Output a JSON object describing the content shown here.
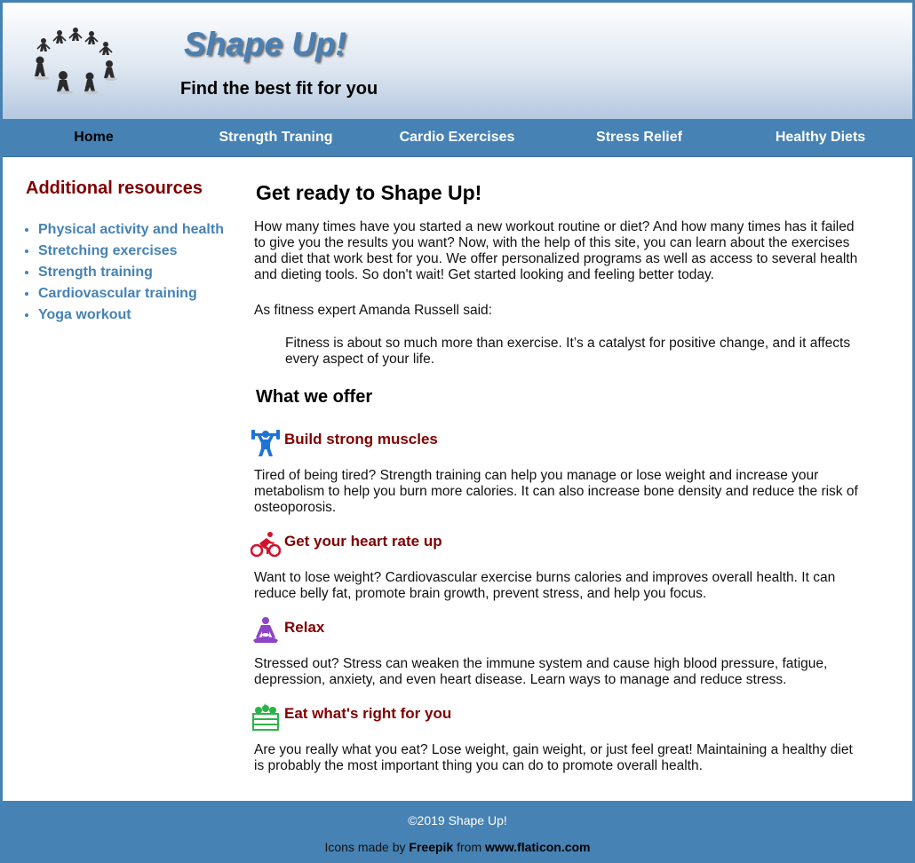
{
  "header": {
    "title": "Shape Up!",
    "tagline": "Find the best fit for you"
  },
  "nav": {
    "items": [
      {
        "label": "Home",
        "active": true
      },
      {
        "label": "Strength Traning",
        "active": false
      },
      {
        "label": "Cardio Exercises",
        "active": false
      },
      {
        "label": "Stress Relief",
        "active": false
      },
      {
        "label": "Healthy Diets",
        "active": false
      }
    ]
  },
  "sidebar": {
    "title": "Additional resources",
    "links": [
      "Physical activity and health",
      "Stretching exercises",
      "Strength training",
      "Cardiovascular training",
      "Yoga workout"
    ]
  },
  "main": {
    "title": "Get ready to Shape Up!",
    "intro": "How many times have you started a new workout routine or diet? And how many times has it failed to give you the results you want? Now, with the help of this site, you can learn about the exercises and diet that work best for you. We offer personalized programs as well as access to several health and dieting tools. So don't wait! Get started looking and feeling better today.",
    "quote_intro": "As fitness expert Amanda Russell said:",
    "quote": "Fitness is about so much more than exercise. It’s a catalyst for positive change, and it affects every aspect of your life.",
    "offer_title": "What we offer",
    "offers": [
      {
        "heading": "Build strong muscles",
        "icon": "weightlifter-icon",
        "text": "Tired of being tired? Strength training can help you manage or lose weight and increase your metabolism to help you burn more calories. It can also increase bone density and reduce the risk of osteoporosis."
      },
      {
        "heading": "Get your heart rate up",
        "icon": "cyclist-icon",
        "text": "Want to lose weight? Cardiovascular exercise burns calories and improves overall health. It can reduce belly fat, promote brain growth, prevent stress, and help you focus."
      },
      {
        "heading": "Relax",
        "icon": "meditation-icon",
        "text": "Stressed out? Stress can weaken the immune system and cause high blood pressure, fatigue, depression, anxiety, and even heart disease. Learn ways to manage and reduce stress."
      },
      {
        "heading": "Eat what's right for you",
        "icon": "vegetable-crate-icon",
        "text": "Are you really what you eat? Lose weight, gain weight, or just feel great! Maintaining a healthy diet is probably the most important thing you can do to promote overall health."
      }
    ]
  },
  "footer": {
    "copyright": "©2019 Shape Up!",
    "credits_prefix": "Icons made by",
    "credits_author": "Freepik",
    "credits_mid": "from",
    "credits_site": "www.flaticon.com"
  },
  "colors": {
    "brand_blue": "#4682b4",
    "heading_maroon": "#800000",
    "muscle_icon": "#1e73d8",
    "cardio_icon": "#d0122c",
    "relax_icon": "#8e44c6",
    "diet_icon": "#2db34a"
  }
}
